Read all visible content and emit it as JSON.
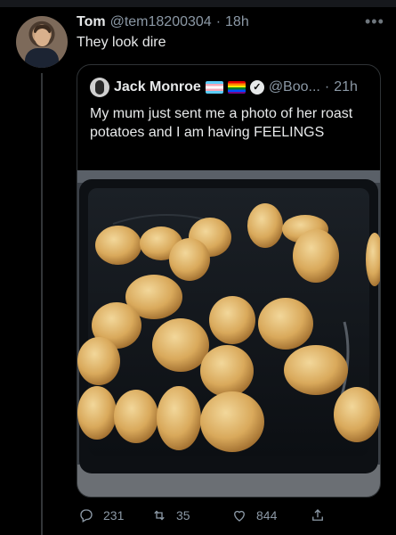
{
  "tweet": {
    "author_name": "Tom",
    "handle": "@tem18200304",
    "separator": "·",
    "time": "18h",
    "text": "They look dire",
    "more_icon": "more-horizontal-icon"
  },
  "quoted_tweet": {
    "author_name": "Jack Monroe",
    "badges": [
      "transgender-flag-emoji",
      "rainbow-flag-emoji",
      "verified-badge-icon"
    ],
    "handle": "@Boo...",
    "separator": "·",
    "time": "21h",
    "text": "My mum just sent me a photo of her roast potatoes and I am having FEELINGS",
    "media": "photo-roast-potatoes-in-baking-tray"
  },
  "actions": {
    "reply_count": "231",
    "retweet_count": "35",
    "like_count": "844",
    "icons": [
      "reply-icon",
      "retweet-icon",
      "like-icon",
      "share-icon"
    ]
  },
  "colors": {
    "background": "#000000",
    "text_primary": "#e7e9ea",
    "text_secondary": "#8b98a5",
    "border": "#2f3336"
  }
}
